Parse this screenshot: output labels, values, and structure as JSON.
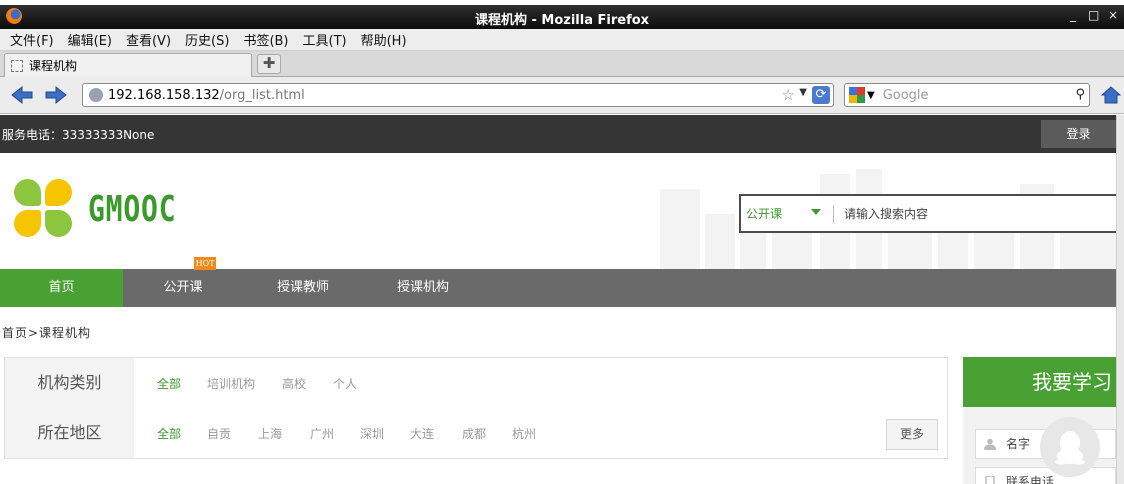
{
  "window": {
    "title": "课程机构 - Mozilla Firefox",
    "controls": [
      "_",
      "□",
      "×"
    ]
  },
  "menu": {
    "items": [
      "文件(F)",
      "编辑(E)",
      "查看(V)",
      "历史(S)",
      "书签(B)",
      "工具(T)",
      "帮助(H)"
    ]
  },
  "tabs": {
    "active_title": "课程机构",
    "new_tab_glyph": "✚"
  },
  "navbar": {
    "url_host": "192.168.158.132",
    "url_path": "/org_list.html",
    "search_placeholder": "Google"
  },
  "site": {
    "service_phone": "服务电话：33333333None",
    "login_label": "登录",
    "brand": "GMOOC",
    "search": {
      "type_label": "公开课",
      "placeholder": "请输入搜索内容"
    },
    "nav": [
      "首页",
      "公开课",
      "授课教师",
      "授课机构"
    ],
    "hot_badge": "HOT",
    "breadcrumb": "首页>课程机构",
    "filters": {
      "category": {
        "label": "机构类别",
        "options": [
          "全部",
          "培训机构",
          "高校",
          "个人"
        ]
      },
      "region": {
        "label": "所在地区",
        "options": [
          "全部",
          "自贡",
          "上海",
          "广州",
          "深圳",
          "大连",
          "成都",
          "杭州"
        ],
        "more_label": "更多"
      }
    },
    "learn_panel": {
      "title": "我要学习",
      "name_field": "名字",
      "phone_field": "联系电话"
    }
  },
  "colors": {
    "accent_green": "#4aa133",
    "brand_green": "#3a9a2b",
    "hot_orange": "#f08a1d",
    "top_strip": "#353535",
    "nav_gray": "#6a6a6a"
  }
}
